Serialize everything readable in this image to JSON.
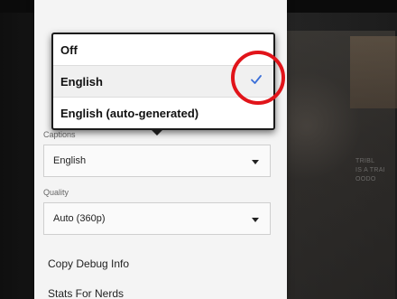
{
  "captions_dropdown": {
    "options": [
      "Off",
      "English",
      "English (auto-generated)"
    ],
    "selected_index": 1,
    "check_icon": "check-icon"
  },
  "settings": {
    "captions_label": "Captions",
    "captions_value": "English",
    "quality_label": "Quality",
    "quality_value": "Auto (360p)",
    "copy_debug": "Copy Debug Info",
    "stats_nerds": "Stats For Nerds"
  },
  "background": {
    "text_line_1": "TRIBL",
    "text_line_2": "IS A TRAI",
    "text_line_3": "OODO"
  },
  "colors": {
    "annotation": "#e1141a",
    "check": "#3b6fd8"
  }
}
